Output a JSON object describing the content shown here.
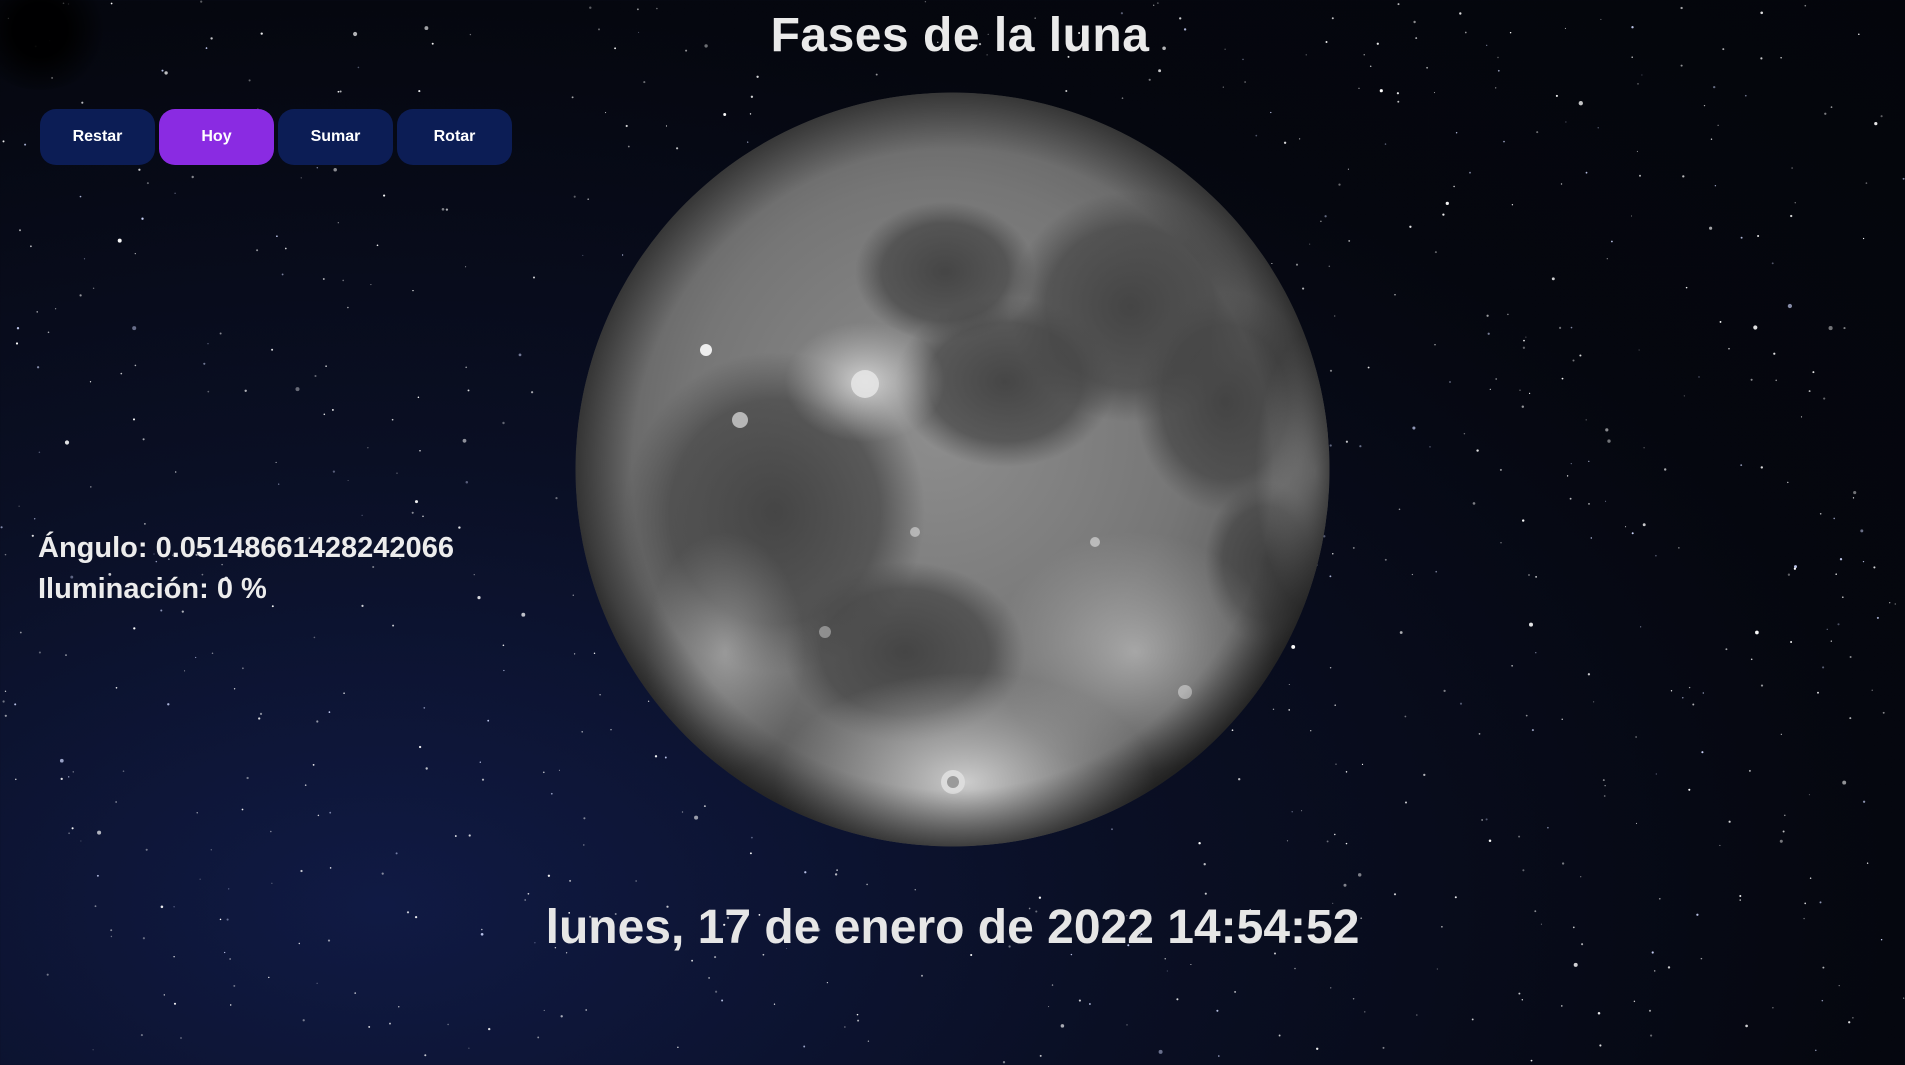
{
  "page": {
    "title": "Fases de la luna",
    "background_color": "#05070f"
  },
  "toolbar": {
    "buttons": [
      {
        "label": "Restar",
        "active": false
      },
      {
        "label": "Hoy",
        "active": true
      },
      {
        "label": "Sumar",
        "active": false
      },
      {
        "label": "Rotar",
        "active": false
      }
    ],
    "button_color": "#0c1d55",
    "active_color": "#8a2be2"
  },
  "info": {
    "angle_label": "Ángulo:",
    "angle_value": "0.05148661428242066",
    "illumination_label": "Iluminación:",
    "illumination_value": "0 %"
  },
  "moon": {
    "icon": "full-moon-image"
  },
  "date_display": "lunes, 17 de enero de 2022 14:54:52"
}
